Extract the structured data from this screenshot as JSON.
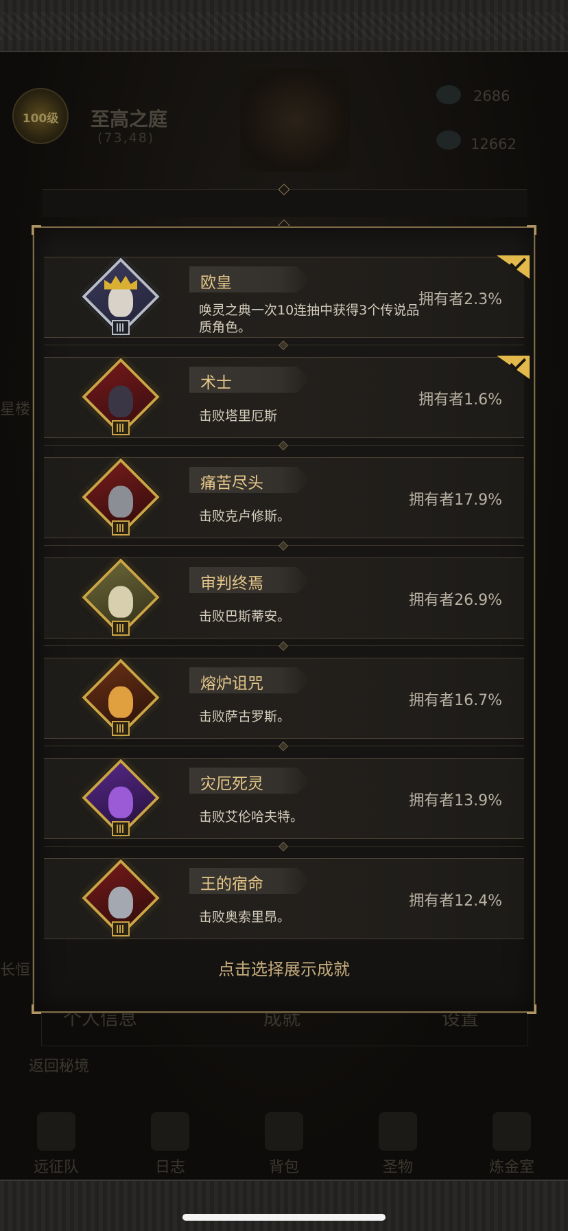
{
  "background": {
    "emblem_text": "100级",
    "location_title": "至高之庭",
    "location_coords": "(73,48)",
    "resource_1": "2686",
    "resource_2": "12662",
    "side_left_1": "星楼",
    "side_left_2": "长恒",
    "tabs": [
      "个人信息",
      "成就",
      "设置"
    ],
    "return_label": "返回秘境",
    "nav": [
      "远征队",
      "日志",
      "背包",
      "圣物",
      "炼金室"
    ]
  },
  "modal": {
    "achievements": [
      {
        "name": "欧皇",
        "description": "唤灵之典一次10连抽中获得3个传说品质角色。",
        "owners": "拥有者2.3%",
        "selected": true,
        "frame": "silver",
        "art": "crowned-king"
      },
      {
        "name": "术士",
        "description": "击败塔里厄斯",
        "owners": "拥有者1.6%",
        "selected": true,
        "frame": "gold",
        "art": "warlock"
      },
      {
        "name": "痛苦尽头",
        "description": "击败克卢修斯。",
        "owners": "拥有者17.9%",
        "selected": false,
        "frame": "gold",
        "art": "spiked-knight"
      },
      {
        "name": "审判终焉",
        "description": "击败巴斯蒂安。",
        "owners": "拥有者26.9%",
        "selected": false,
        "frame": "gold",
        "art": "judge"
      },
      {
        "name": "熔炉诅咒",
        "description": "击败萨古罗斯。",
        "owners": "拥有者16.7%",
        "selected": false,
        "frame": "gold",
        "art": "forge-demon"
      },
      {
        "name": "灾厄死灵",
        "description": "击败艾伦哈夫特。",
        "owners": "拥有者13.9%",
        "selected": false,
        "frame": "gold",
        "art": "necromancer"
      },
      {
        "name": "王的宿命",
        "description": "击败奥索里昂。",
        "owners": "拥有者12.4%",
        "selected": false,
        "frame": "gold",
        "art": "fallen-king"
      }
    ],
    "footer_hint": "点击选择展示成就"
  },
  "colors": {
    "gold_frame": "#c9a546",
    "silver_frame": "#b8bcc4",
    "name_text": "#e6c88a",
    "check_badge": "#e2b94a"
  }
}
